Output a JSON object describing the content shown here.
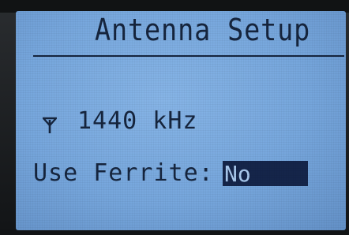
{
  "screen": {
    "title": "Antenna Setup"
  },
  "frequency": {
    "icon": "antenna-icon",
    "value": "1440 kHz"
  },
  "ferrite": {
    "label": "Use Ferrite:",
    "value": "No"
  },
  "colors": {
    "lcd_background": "#7fb0e4",
    "pixel_dark": "#16253e",
    "highlight_fill": "#15254a",
    "highlight_text": "#a9c9ee"
  }
}
